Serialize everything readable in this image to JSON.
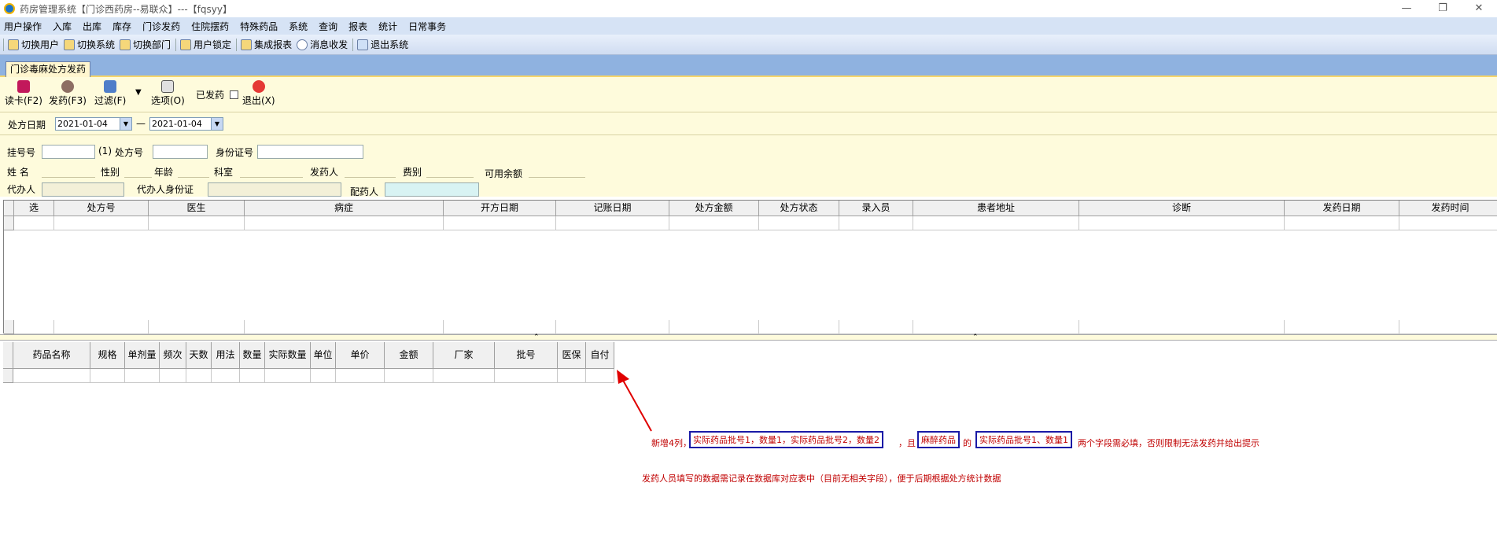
{
  "window": {
    "title": "药房管理系统【门诊西药房--易联众】---【fqsyy】",
    "controls": [
      "—",
      "❐",
      "✕"
    ]
  },
  "menu": [
    "用户操作",
    "入库",
    "出库",
    "库存",
    "门诊发药",
    "住院摆药",
    "特殊药品",
    "系统",
    "查询",
    "报表",
    "统计",
    "日常事务"
  ],
  "toolbar": [
    {
      "label": "切换用户",
      "icon": "users-icon"
    },
    {
      "label": "切换系统",
      "icon": "switch-icon"
    },
    {
      "label": "切换部门",
      "icon": "department-icon"
    },
    {
      "label": "用户锁定",
      "icon": "lock-user-icon"
    },
    {
      "label": "集成报表",
      "icon": "report-icon"
    },
    {
      "label": "消息收发",
      "icon": "info-icon"
    },
    {
      "label": "退出系统",
      "icon": "exit-icon"
    }
  ],
  "tab": {
    "label": "门诊毒麻处方发药"
  },
  "actions": {
    "read_card": "读卡(F2)",
    "dispense": "发药(F3)",
    "filter": "过滤(F)",
    "options": "选项(O)",
    "dispensed": "已发药",
    "exit": "退出(X)"
  },
  "date_filter": {
    "label": "处方日期",
    "from": "2021-01-04",
    "to": "2021-01-04",
    "dash": "—"
  },
  "fields": {
    "reg_no": "挂号号",
    "rx_marker": "(1)",
    "rx_no": "处方号",
    "id_no": "身份证号",
    "name": "姓    名",
    "gender": "性别",
    "age": "年龄",
    "dept": "科室",
    "dispenser": "发药人",
    "fee_type": "费别",
    "balance": "可用余额",
    "agent": "代办人",
    "agent_id": "代办人身份证",
    "preparer": "配药人"
  },
  "grid1": {
    "columns": [
      "选",
      "处方号",
      "医生",
      "病症",
      "开方日期",
      "记账日期",
      "处方金额",
      "处方状态",
      "录入员",
      "患者地址",
      "诊断",
      "发药日期",
      "发药时间"
    ]
  },
  "grid2": {
    "columns": [
      "药品名称",
      "规格",
      "单剂量",
      "频次",
      "天数",
      "用法",
      "数量",
      "实际数量",
      "单位",
      "单价",
      "金额",
      "厂家",
      "批号",
      "医保",
      "自付"
    ]
  },
  "annotation": {
    "prefix": "新增4列，",
    "box1": "实际药品批号1，数量1，实际药品批号2，数量2",
    "mid1": "，且",
    "box2": "麻醉药品",
    "mid2": "的",
    "box3": "实际药品批号1、数量1",
    "suffix": "两个字段需必填，否则限制无法发药并给出提示",
    "line2": "发药人员填写的数据需记录在数据库对应表中（目前无相关字段），便于后期根据处方统计数据"
  },
  "colors": {
    "menubar": "#d6e3f5",
    "panel": "#fefbdc",
    "annotation": "#c00000",
    "box": "#1a1aa6"
  }
}
